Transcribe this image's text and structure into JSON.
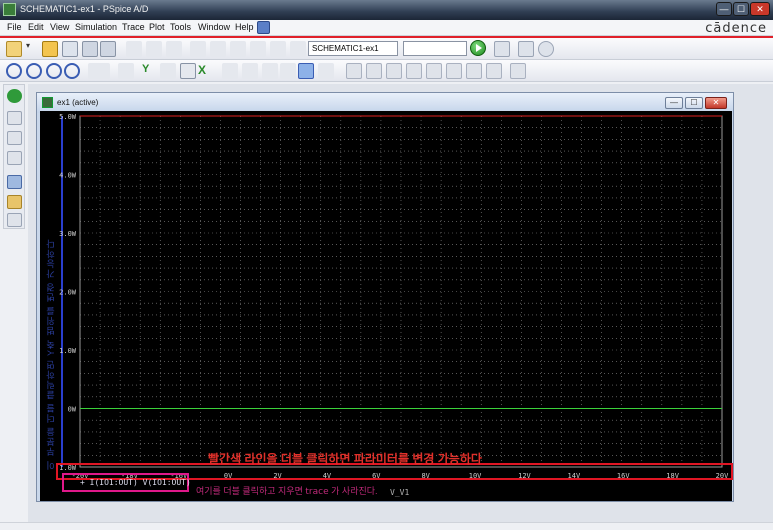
{
  "window": {
    "title": "SCHEMATIC1-ex1 - PSpice A/D",
    "brand": "cādence",
    "minimize": "—",
    "maximize": "☐",
    "close": "✕"
  },
  "menu": [
    "File",
    "Edit",
    "View",
    "Simulation",
    "Trace",
    "Plot",
    "Tools",
    "Window",
    "Help"
  ],
  "toolbar": {
    "profile_value": "SCHEMATIC1-ex1",
    "second_value": ""
  },
  "plot_window": {
    "title": "ex1 (active)"
  },
  "chart_data": {
    "type": "line",
    "x_tick_labels": [
      "-20V",
      "-18V",
      "-16V",
      "0V",
      "2V",
      "4V",
      "6V",
      "8V",
      "10V",
      "12V",
      "14V",
      "16V",
      "18V",
      "20V"
    ],
    "y_tick_labels": [
      "5.0W",
      "4.0W",
      "3.0W",
      "2.0W",
      "1.0W",
      "0W",
      "-1.0W"
    ],
    "ylim": [
      -1.0,
      5.0
    ],
    "xlim": [
      -20,
      20
    ],
    "x_axis_name": "V_V1",
    "grid": true,
    "series": [
      {
        "name": "V(IO1:OUT)",
        "color": "#3ad13a",
        "x": [
          -20,
          20
        ],
        "y": [
          0,
          0
        ]
      },
      {
        "name": "",
        "color": "#e02020",
        "x": [
          -20,
          20
        ],
        "y": [
          5.0,
          5.0
        ]
      }
    ],
    "legend": [
      "+ I(IO1:OUT)",
      "V(IO1:OUT)"
    ]
  },
  "annotations": {
    "main": "빨간색 라인을 더블 클릭하면 파라미터를 변경 가능하다",
    "bottom_prefix": "여기를 더블 클릭하고 지우면",
    "bottom_trace": "trace",
    "bottom_suffix": "가 사라진다.",
    "y_axis_note": "이 부분을 더블 클릭하면 Y축 범위를 변경 가능하다"
  },
  "colors": {
    "accent_red": "#e01624",
    "accent_pink": "#e0188a",
    "plot_bg": "#000000"
  }
}
